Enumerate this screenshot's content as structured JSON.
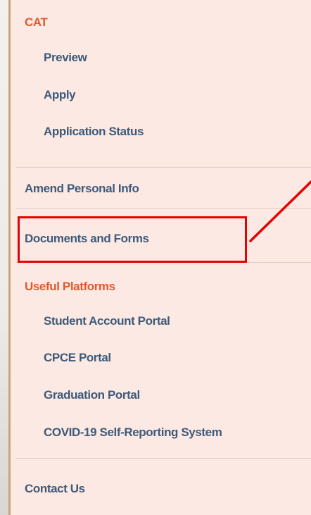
{
  "nav": {
    "cat_heading": "CAT",
    "cat_items": [
      {
        "label": "Preview"
      },
      {
        "label": "Apply"
      },
      {
        "label": "Application Status"
      }
    ],
    "amend_personal_info": "Amend Personal Info",
    "documents_and_forms": "Documents and Forms",
    "useful_platforms_heading": "Useful Platforms",
    "platform_items": [
      {
        "label": "Student Account Portal"
      },
      {
        "label": "CPCE Portal"
      },
      {
        "label": "Graduation Portal"
      },
      {
        "label": "COVID-19 Self-Reporting System"
      }
    ],
    "contact_us": "Contact Us"
  },
  "colors": {
    "panel_background": "#fce9e3",
    "heading": "#e05a2b",
    "link": "#3d5a7a",
    "annotation_red": "#e60000"
  }
}
